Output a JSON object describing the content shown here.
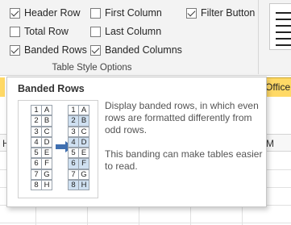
{
  "ribbon": {
    "options": {
      "header_row": {
        "label": "Header Row",
        "checked": true
      },
      "total_row": {
        "label": "Total Row",
        "checked": false
      },
      "banded_rows": {
        "label": "Banded Rows",
        "checked": true
      },
      "first_column": {
        "label": "First Column",
        "checked": false
      },
      "last_column": {
        "label": "Last Column",
        "checked": false
      },
      "banded_columns": {
        "label": "Banded Columns",
        "checked": true
      },
      "filter_button": {
        "label": "Filter Button",
        "checked": true
      }
    },
    "group_label": "Table Style Options"
  },
  "sheet": {
    "cell_office": "Office",
    "peek_left_letter": "H",
    "peek_right_letter": "M"
  },
  "tooltip": {
    "title": "Banded Rows",
    "description": "Display banded rows, in which even rows are formatted differently from odd rows.",
    "description2": "This banding can make tables easier to read.",
    "illustration": {
      "left_table": [
        [
          "1",
          "A"
        ],
        [
          "2",
          "B"
        ],
        [
          "3",
          "C"
        ],
        [
          "4",
          "D"
        ],
        [
          "5",
          "E"
        ],
        [
          "6",
          "F"
        ],
        [
          "7",
          "G"
        ],
        [
          "8",
          "H"
        ]
      ],
      "right_table": [
        [
          "1",
          "A"
        ],
        [
          "2",
          "B"
        ],
        [
          "3",
          "C"
        ],
        [
          "4",
          "D"
        ],
        [
          "5",
          "E"
        ],
        [
          "6",
          "F"
        ],
        [
          "7",
          "G"
        ],
        [
          "8",
          "H"
        ]
      ],
      "band_color": "#cfe0f1",
      "arrow_color": "#3f6fb0",
      "arrow_icon": "arrow-right-icon"
    }
  }
}
